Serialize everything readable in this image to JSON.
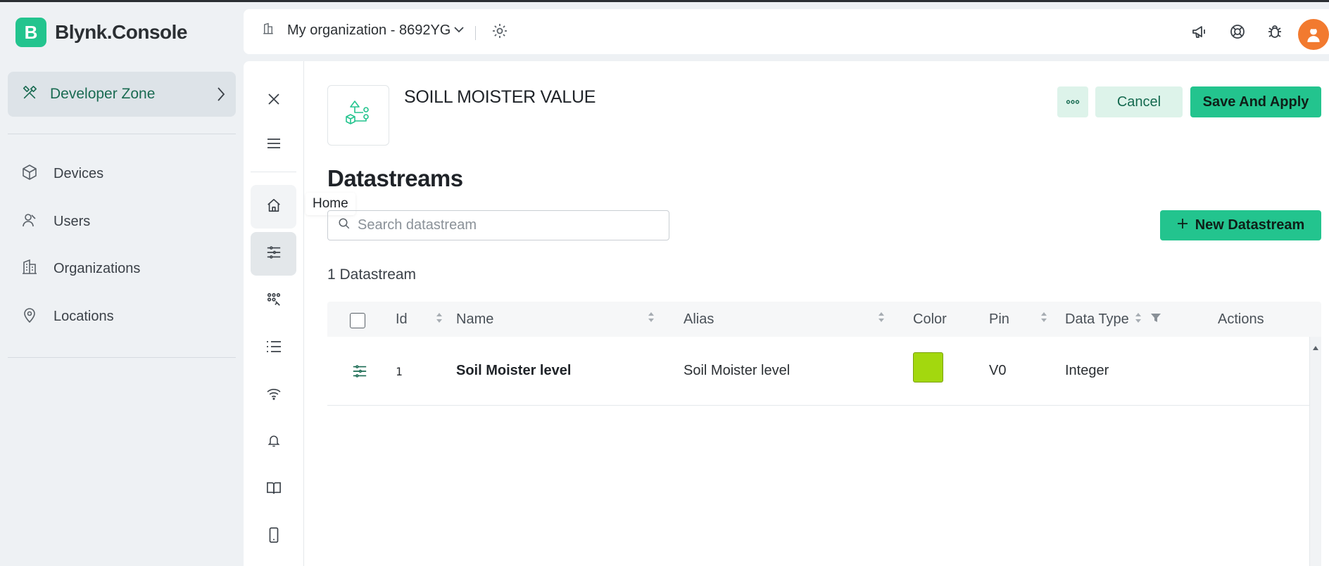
{
  "app": {
    "logo_letter": "B",
    "name": "Blynk.Console",
    "brand_color": "#23c48e"
  },
  "sidebar": {
    "developer_zone": "Developer Zone",
    "items": [
      {
        "label": "Devices",
        "icon": "cube-icon"
      },
      {
        "label": "Users",
        "icon": "user-icon"
      },
      {
        "label": "Organizations",
        "icon": "building-icon"
      },
      {
        "label": "Locations",
        "icon": "pin-icon"
      }
    ]
  },
  "header": {
    "organization": "My organization - 8692YG",
    "icons": [
      "megaphone-icon",
      "help-ring-icon",
      "bug-icon",
      "avatar"
    ]
  },
  "rail": {
    "items": [
      "close-icon",
      "menu-icon",
      "home-icon",
      "datastreams-icon",
      "events-icon",
      "list-icon",
      "wifi-icon",
      "bell-icon",
      "book-icon",
      "mobile-icon"
    ],
    "tooltip": "Home"
  },
  "template": {
    "name": "SOILL MOISTER VALUE",
    "cancel_label": "Cancel",
    "save_label": "Save And Apply"
  },
  "datastreams": {
    "title": "Datastreams",
    "search_placeholder": "Search datastream",
    "new_label": "New Datastream",
    "count_label": "1 Datastream",
    "columns": [
      "Id",
      "Name",
      "Alias",
      "Color",
      "Pin",
      "Data Type",
      "Actions"
    ],
    "rows": [
      {
        "id": "1",
        "name": "Soil Moister level",
        "alias": "Soil Moister level",
        "color": "#a3d80e",
        "pin": "V0",
        "data_type": "Integer"
      }
    ]
  }
}
